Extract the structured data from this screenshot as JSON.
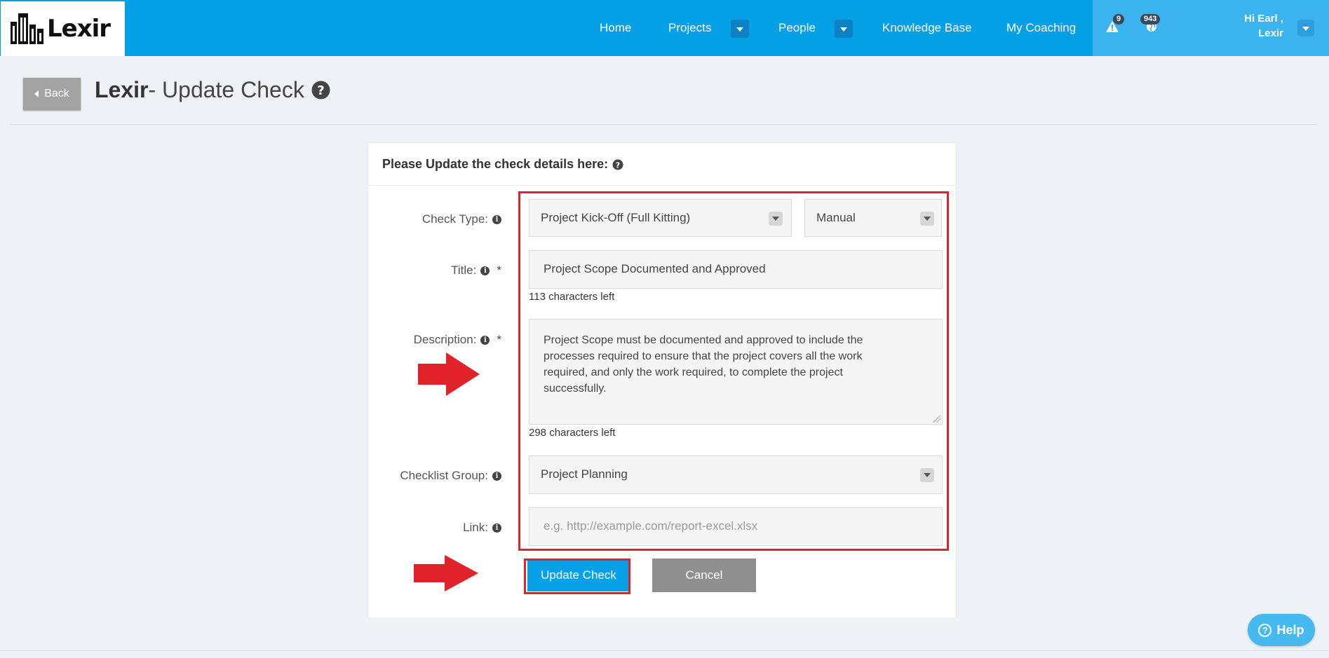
{
  "app": {
    "logo_text": "Lexir"
  },
  "nav": {
    "items": [
      {
        "label": "Home"
      },
      {
        "label": "Projects"
      },
      {
        "label": "People"
      },
      {
        "label": "Knowledge Base"
      },
      {
        "label": "My Coaching"
      }
    ],
    "alerts_count": "9",
    "globe_count": "943",
    "greeting_line1": "Hi Earl ,",
    "greeting_line2": "Lexir"
  },
  "header": {
    "back_label": "Back",
    "title_brand": "Lexir",
    "title_rest": "- Update Check"
  },
  "form": {
    "card_title": "Please Update the check details here:",
    "check_type_label": "Check Type:",
    "check_type_value": "Project Kick-Off (Full Kitting)",
    "check_mode_value": "Manual",
    "title_label": "Title:",
    "title_value": "Project Scope Documented and Approved",
    "title_hint": "113 characters left",
    "description_label": "Description:",
    "description_value": "Project Scope must be documented and approved to include the processes required to ensure that the project covers all the work required, and only the work required, to complete the project successfully.",
    "description_hint": "298 characters left",
    "group_label": "Checklist Group:",
    "group_value": "Project Planning",
    "link_label": "Link:",
    "link_placeholder": "e.g. http://example.com/report-excel.xlsx",
    "required_mark": "*",
    "update_label": "Update Check",
    "cancel_label": "Cancel"
  },
  "help": {
    "label": "Help"
  },
  "colors": {
    "topbar": "#03a0e6",
    "annotation_red": "#e0222a",
    "primary_button": "#08a0e6",
    "cancel_button": "#8f8f8f"
  }
}
